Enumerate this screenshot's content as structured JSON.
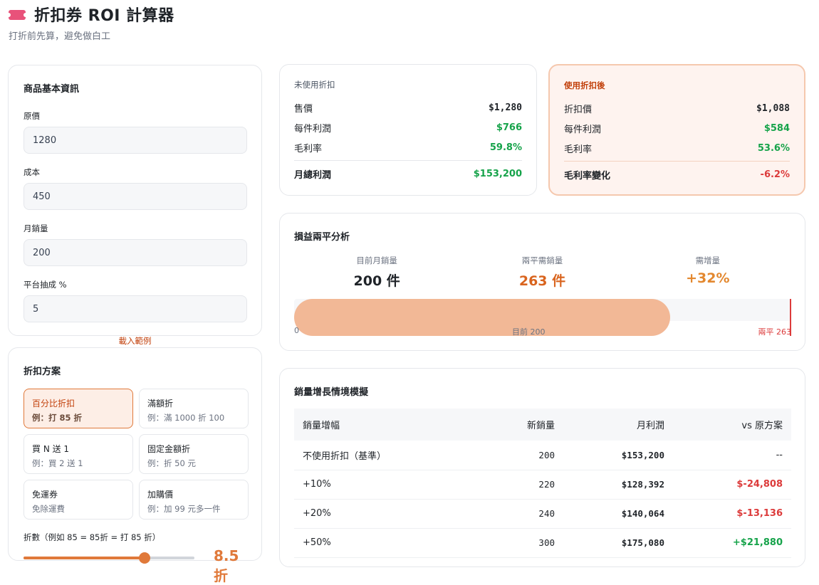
{
  "header": {
    "title": "折扣券 ROI 計算器",
    "subtitle": "打折前先算，避免做白工",
    "icon": "ticket-icon"
  },
  "product": {
    "title": "商品基本資訊",
    "fields": [
      {
        "label": "原價",
        "value": "1280"
      },
      {
        "label": "成本",
        "value": "450"
      },
      {
        "label": "月銷量",
        "value": "200"
      },
      {
        "label": "平台抽成 %",
        "value": "5"
      }
    ],
    "load_example": "載入範例"
  },
  "plan": {
    "title": "折扣方案",
    "options": [
      {
        "name": "百分比折扣",
        "desc": "例：打 85 折",
        "active": true
      },
      {
        "name": "滿額折",
        "desc": "例：滿 1000 折 100",
        "active": false
      },
      {
        "name": "買 N 送 1",
        "desc": "例：買 2 送 1",
        "active": false
      },
      {
        "name": "固定金額折",
        "desc": "例：折 50 元",
        "active": false
      },
      {
        "name": "免運券",
        "desc": "免除運費",
        "active": false
      },
      {
        "name": "加購價",
        "desc": "例：加 99 元多一件",
        "active": false
      }
    ],
    "discount_label": "折數（例如 85 = 85折 = 打 85 折）",
    "slider_value": 85,
    "slider_display": "8.5 折"
  },
  "before": {
    "heading": "未使用折扣",
    "rows": [
      {
        "label": "售價",
        "value": "$1,280"
      },
      {
        "label": "每件利潤",
        "value": "$766"
      },
      {
        "label": "毛利率",
        "value": "59.8%"
      }
    ],
    "total": {
      "label": "月總利潤",
      "value": "$153,200"
    }
  },
  "after": {
    "heading": "使用折扣後",
    "rows": [
      {
        "label": "折扣價",
        "value": "$1,088"
      },
      {
        "label": "每件利潤",
        "value": "$584"
      },
      {
        "label": "毛利率",
        "value": "53.6%"
      }
    ],
    "total": {
      "label": "毛利率變化",
      "value": "-6.2%"
    }
  },
  "breakeven": {
    "title": "損益兩平分析",
    "stats": [
      {
        "caption": "目前月銷量",
        "value": "200 件"
      },
      {
        "caption": "兩平需銷量",
        "value": "263 件"
      },
      {
        "caption": "需增量",
        "value": "+32%"
      }
    ],
    "bar": {
      "current": 200,
      "breakeven": 263,
      "start_label": "0",
      "current_label": "目前 200",
      "end_label": "兩平 263"
    }
  },
  "scenario": {
    "title": "銷量增長情境模擬",
    "columns": [
      "銷量增幅",
      "新銷量",
      "月利潤",
      "vs 原方案"
    ],
    "rows": [
      {
        "growth": "不使用折扣（基準）",
        "qty": "200",
        "profit": "$153,200",
        "diff": "--",
        "trend": "none"
      },
      {
        "growth": "+10%",
        "qty": "220",
        "profit": "$128,392",
        "diff": "$-24,808",
        "trend": "neg"
      },
      {
        "growth": "+20%",
        "qty": "240",
        "profit": "$140,064",
        "diff": "$-13,136",
        "trend": "neg"
      },
      {
        "growth": "+50%",
        "qty": "300",
        "profit": "$175,080",
        "diff": "+$21,880",
        "trend": "pos"
      }
    ]
  },
  "colors": {
    "accent": "#e0793a",
    "green": "#16a34a",
    "red": "#dc3b3b",
    "brand": "#e8527a"
  }
}
